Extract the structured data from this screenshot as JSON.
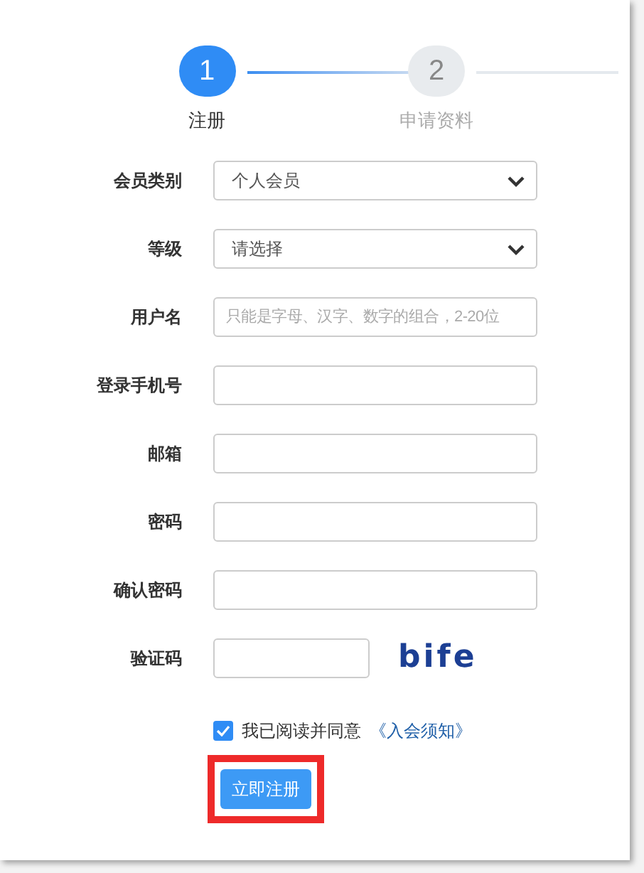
{
  "steps": [
    {
      "number": "1",
      "label": "注册",
      "selected": true
    },
    {
      "number": "2",
      "label": "申请资料",
      "selected": false
    }
  ],
  "fields": [
    {
      "kind": "select",
      "label": "会员类别",
      "value": "个人会员"
    },
    {
      "kind": "select",
      "label": "等级",
      "value": "请选择"
    },
    {
      "kind": "input",
      "label": "用户名",
      "placeholder": "只能是字母、汉字、数字的组合，2-20位"
    },
    {
      "kind": "input",
      "label": "登录手机号"
    },
    {
      "kind": "input",
      "label": "邮箱"
    },
    {
      "kind": "input",
      "label": "密码"
    },
    {
      "kind": "input",
      "label": "确认密码"
    },
    {
      "kind": "captcha",
      "label": "验证码",
      "captcha": "bife"
    }
  ],
  "agreement": {
    "checked": true,
    "text": "我已阅读并同意",
    "link": "《入会须知》"
  },
  "submit": {
    "label": "立即注册",
    "highlighted": true
  }
}
